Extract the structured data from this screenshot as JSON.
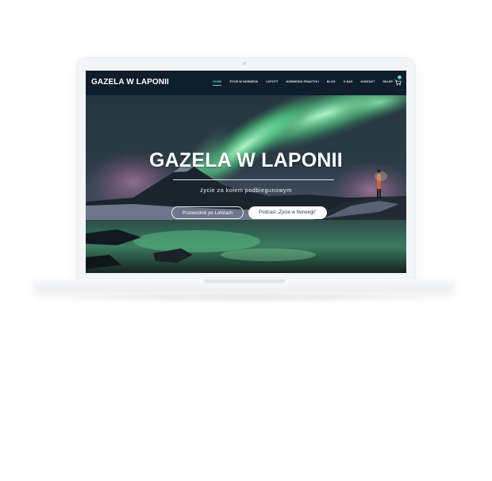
{
  "site": {
    "brand": "GAZELA W LAPONII",
    "nav": [
      {
        "label": "HOME",
        "active": true
      },
      {
        "label": "ŻYCIE W NORWEGII",
        "active": false
      },
      {
        "label": "LOFOTY",
        "active": false
      },
      {
        "label": "NORWEGIO PRAKTYKI",
        "active": false
      },
      {
        "label": "BLOG",
        "active": false
      },
      {
        "label": "O NAS",
        "active": false
      },
      {
        "label": "KONTAKT",
        "active": false
      },
      {
        "label": "SKLEP",
        "active": false
      }
    ],
    "cart_count": "0"
  },
  "hero": {
    "title": "GAZELA W LAPONII",
    "subtitle": "życie za kołem podbiegunowym",
    "button_outline": "Przewodnik po Lofotach",
    "button_solid": "Podcast „Życie w Norwegii”"
  },
  "colors": {
    "navbar": "#0f1e2a",
    "accent": "#6ec0d8",
    "aurora": "#7dffb0"
  },
  "icons": [
    "cart-icon"
  ]
}
